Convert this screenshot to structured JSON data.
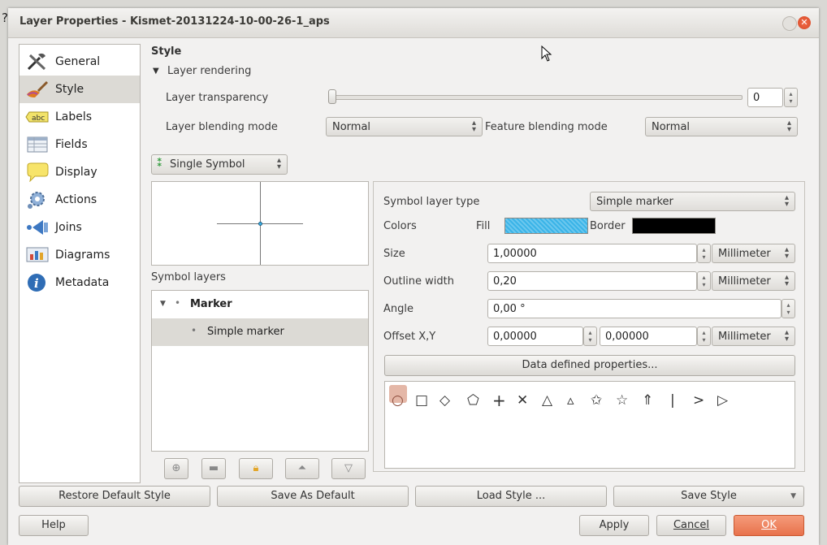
{
  "window": {
    "title": "Layer Properties - Kismet-20131224-10-00-26-1_aps",
    "corner_char": "?"
  },
  "sidebar": {
    "items": [
      {
        "label": "General",
        "icon": "tools-icon"
      },
      {
        "label": "Style",
        "icon": "paintbrush-icon"
      },
      {
        "label": "Labels",
        "icon": "abc-labels-icon"
      },
      {
        "label": "Fields",
        "icon": "table-icon"
      },
      {
        "label": "Display",
        "icon": "speech-bubble-icon"
      },
      {
        "label": "Actions",
        "icon": "gear-icon"
      },
      {
        "label": "Joins",
        "icon": "joins-icon"
      },
      {
        "label": "Diagrams",
        "icon": "diagram-icon"
      },
      {
        "label": "Metadata",
        "icon": "info-icon"
      }
    ],
    "selected": "Style"
  },
  "style": {
    "heading": "Style",
    "layer_rendering": "Layer rendering",
    "transparency_label": "Layer transparency",
    "transparency_value": "0",
    "transparency_fraction": 0,
    "blending_label": "Layer blending mode",
    "blending_value": "Normal",
    "feature_blending_label": "Feature blending mode",
    "feature_blending_value": "Normal",
    "renderer": "Single Symbol"
  },
  "symbol_layers": {
    "heading": "Symbol layers",
    "root": "Marker",
    "child": "Simple marker"
  },
  "symbol_props": {
    "type_label": "Symbol layer type",
    "type_value": "Simple marker",
    "colors_label": "Colors",
    "fill_label": "Fill",
    "border_label": "Border",
    "fill_color": "#3ab4e8",
    "border_color": "#000000",
    "size_label": "Size",
    "size_value": "1,00000",
    "size_unit": "Millimeter",
    "outline_label": "Outline width",
    "outline_value": "0,20",
    "outline_unit": "Millimeter",
    "angle_label": "Angle",
    "angle_value": "0,00 °",
    "offset_label": "Offset X,Y",
    "offset_x": "0,00000",
    "offset_y": "0,00000",
    "offset_unit": "Millimeter",
    "data_defined": "Data defined properties...",
    "shapes": [
      "○",
      "□",
      "◇",
      "⬠",
      "+",
      "✕",
      "△",
      "▵",
      "✩",
      "☆",
      "⇑",
      "|",
      ">",
      "▷"
    ]
  },
  "footer": {
    "restore": "Restore Default Style",
    "save_default": "Save As Default",
    "load": "Load Style ...",
    "save_style": "Save Style",
    "help": "Help",
    "apply": "Apply",
    "cancel": "Cancel",
    "ok": "OK"
  }
}
